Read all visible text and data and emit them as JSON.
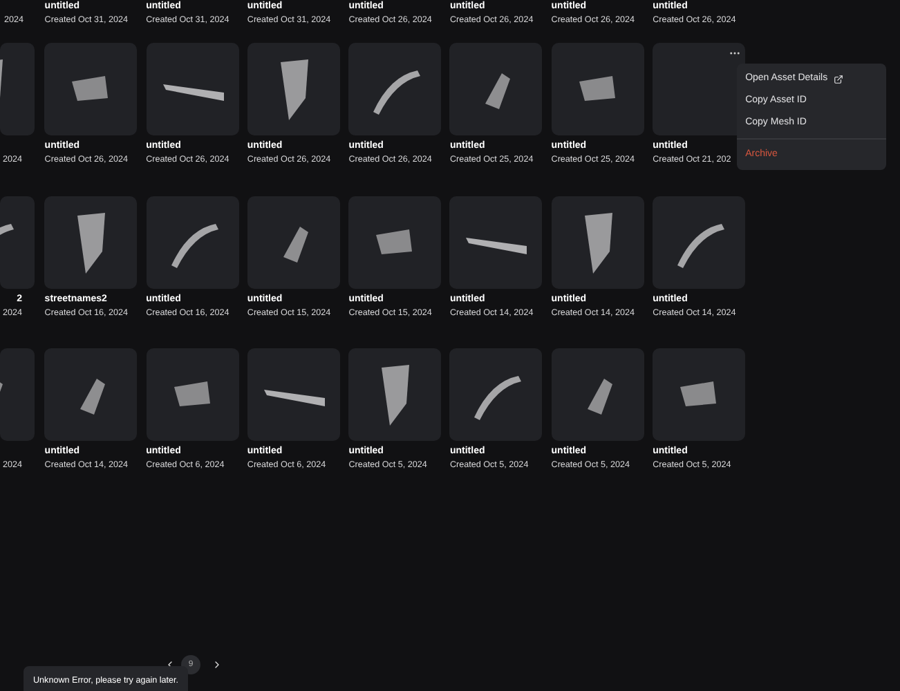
{
  "top_row": {
    "edge_date": "2024",
    "assets": [
      {
        "title": "untitled",
        "date": "Created Oct 31, 2024"
      },
      {
        "title": "untitled",
        "date": "Created Oct 31, 2024"
      },
      {
        "title": "untitled",
        "date": "Created Oct 31, 2024"
      },
      {
        "title": "untitled",
        "date": "Created Oct 26, 2024"
      },
      {
        "title": "untitled",
        "date": "Created Oct 26, 2024"
      },
      {
        "title": "untitled",
        "date": "Created Oct 26, 2024"
      },
      {
        "title": "untitled",
        "date": "Created Oct 26, 2024"
      }
    ]
  },
  "rows": [
    {
      "edge": {
        "date": "2024"
      },
      "assets": [
        {
          "title": "untitled",
          "date": "Created Oct 26, 2024",
          "menu_open": false
        },
        {
          "title": "untitled",
          "date": "Created Oct 26, 2024",
          "menu_open": false
        },
        {
          "title": "untitled",
          "date": "Created Oct 26, 2024",
          "menu_open": false
        },
        {
          "title": "untitled",
          "date": "Created Oct 26, 2024",
          "menu_open": false
        },
        {
          "title": "untitled",
          "date": "Created Oct 25, 2024",
          "menu_open": false
        },
        {
          "title": "untitled",
          "date": "Created Oct 25, 2024",
          "menu_open": false
        },
        {
          "title": "untitled",
          "date": "Created Oct 21, 202",
          "menu_open": true
        }
      ]
    },
    {
      "edge": {
        "title": "2",
        "date": "2024"
      },
      "assets": [
        {
          "title": "streetnames2",
          "date": "Created Oct 16, 2024",
          "menu_open": false
        },
        {
          "title": "untitled",
          "date": "Created Oct 16, 2024",
          "menu_open": false
        },
        {
          "title": "untitled",
          "date": "Created Oct 15, 2024",
          "menu_open": false
        },
        {
          "title": "untitled",
          "date": "Created Oct 15, 2024",
          "menu_open": false
        },
        {
          "title": "untitled",
          "date": "Created Oct 14, 2024",
          "menu_open": false
        },
        {
          "title": "untitled",
          "date": "Created Oct 14, 2024",
          "menu_open": false
        },
        {
          "title": "untitled",
          "date": "Created Oct 14, 2024",
          "menu_open": false
        }
      ]
    },
    {
      "edge": {
        "date": "2024"
      },
      "assets": [
        {
          "title": "untitled",
          "date": "Created Oct 14, 2024",
          "menu_open": false
        },
        {
          "title": "untitled",
          "date": "Created Oct 6, 2024",
          "menu_open": false
        },
        {
          "title": "untitled",
          "date": "Created Oct 6, 2024",
          "menu_open": false
        },
        {
          "title": "untitled",
          "date": "Created Oct 5, 2024",
          "menu_open": false
        },
        {
          "title": "untitled",
          "date": "Created Oct 5, 2024",
          "menu_open": false
        },
        {
          "title": "untitled",
          "date": "Created Oct 5, 2024",
          "menu_open": false
        },
        {
          "title": "untitled",
          "date": "Created Oct 5, 2024",
          "menu_open": false
        }
      ]
    }
  ],
  "context_menu": {
    "items": [
      {
        "label": "Open Asset Details",
        "kind": "external"
      },
      {
        "label": "Copy Asset ID",
        "kind": "plain"
      },
      {
        "label": "Copy Mesh ID",
        "kind": "plain"
      },
      {
        "label": "Archive",
        "kind": "danger"
      }
    ]
  },
  "pagination": {
    "pages": [
      {
        "label": "9",
        "selected": true
      }
    ]
  },
  "toast": {
    "message": "Unknown Error, please try again later."
  }
}
